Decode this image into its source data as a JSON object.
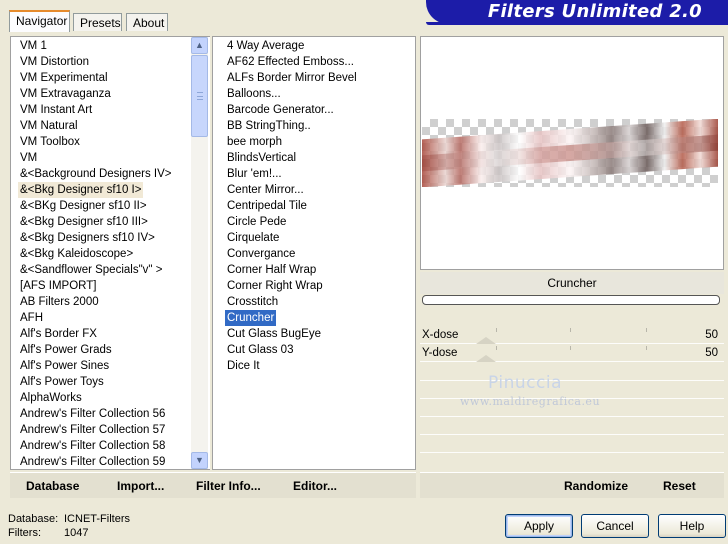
{
  "app": {
    "title": "Filters Unlimited 2.0"
  },
  "tabs": [
    {
      "label": "Navigator",
      "active": true
    },
    {
      "label": "Presets",
      "active": false
    },
    {
      "label": "About",
      "active": false
    }
  ],
  "categories": [
    "VM 1",
    "VM Distortion",
    "VM Experimental",
    "VM Extravaganza",
    "VM Instant Art",
    "VM Natural",
    "VM Toolbox",
    "VM",
    "&<Background Designers IV>",
    "&<Bkg Designer sf10 I>",
    "&<BKg Designer sf10 II>",
    "&<Bkg Designer sf10 III>",
    "&<Bkg Designers sf10 IV>",
    "&<Bkg Kaleidoscope>",
    "&<Sandflower Specials\"v\" >",
    "[AFS IMPORT]",
    "AB Filters 2000",
    "AFH",
    "Alf's Border FX",
    "Alf's Power Grads",
    "Alf's Power Sines",
    "Alf's Power Toys",
    "AlphaWorks",
    "Andrew's Filter Collection 56",
    "Andrew's Filter Collection 57",
    "Andrew's Filter Collection 58",
    "Andrew's Filter Collection 59"
  ],
  "selected_category": "&<Bkg Designer sf10 I>",
  "filters": [
    "4 Way Average",
    "AF62 Effected Emboss...",
    "ALFs Border Mirror Bevel",
    "Balloons...",
    "Barcode Generator...",
    "BB StringThing..",
    "bee morph",
    "BlindsVertical",
    "Blur 'em!...",
    "Center Mirror...",
    "Centripedal Tile",
    "Circle Pede",
    "Cirquelate",
    "Convergance",
    "Corner Half Wrap",
    "Corner Right Wrap",
    "Crosstitch",
    "Cruncher",
    "Cut Glass  BugEye",
    "Cut Glass 03",
    "Dice It"
  ],
  "selected_filter": "Cruncher",
  "current_filter_name": "Cruncher",
  "params": [
    {
      "label": "X-dose",
      "value": "50",
      "level": 50
    },
    {
      "label": "Y-dose",
      "value": "50",
      "level": 50
    }
  ],
  "watermark": {
    "name": "Pinuccia",
    "site": "www.maldiregrafica.eu"
  },
  "toolbar_left": {
    "database": "Database",
    "import": "Import...",
    "filter_info": "Filter Info...",
    "editor": "Editor..."
  },
  "toolbar_right": {
    "randomize": "Randomize",
    "reset": "Reset"
  },
  "status": {
    "database_label": "Database:",
    "database_value": "ICNET-Filters",
    "filters_label": "Filters:",
    "filters_value": "1047"
  },
  "buttons": {
    "apply": "Apply",
    "cancel": "Cancel",
    "help": "Help"
  },
  "colors": {
    "banner": "#1c1ca8",
    "selection": "#316ac5",
    "tab_accent": "#e68b2c"
  }
}
